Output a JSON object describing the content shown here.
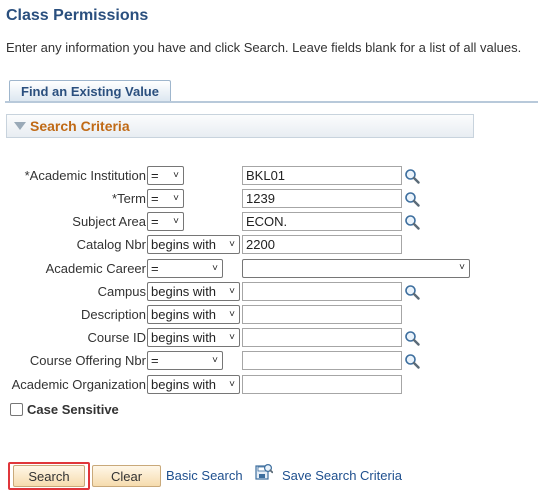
{
  "page": {
    "title": "Class Permissions",
    "instructions": "Enter any information you have and click Search. Leave fields blank for a list of all values."
  },
  "tabs": {
    "find_existing": "Find an Existing Value"
  },
  "criteria": {
    "heading": "Search Criteria"
  },
  "fields": {
    "academic_institution": {
      "label": "*Academic Institution",
      "operator": "=",
      "value": "BKL01"
    },
    "term": {
      "label": "*Term",
      "operator": "=",
      "value": "1239"
    },
    "subject_area": {
      "label": "Subject Area",
      "operator": "=",
      "value": "ECON."
    },
    "catalog_nbr": {
      "label": "Catalog Nbr",
      "operator": "begins with",
      "value": "2200"
    },
    "academic_career": {
      "label": "Academic Career",
      "operator": "=",
      "value": ""
    },
    "campus": {
      "label": "Campus",
      "operator": "begins with",
      "value": ""
    },
    "description": {
      "label": "Description",
      "operator": "begins with",
      "value": ""
    },
    "course_id": {
      "label": "Course ID",
      "operator": "begins with",
      "value": ""
    },
    "course_offering_nbr": {
      "label": "Course Offering Nbr",
      "operator": "=",
      "value": ""
    },
    "academic_organization": {
      "label": "Academic Organization",
      "operator": "begins with",
      "value": ""
    }
  },
  "case_sensitive": {
    "label": "Case Sensitive",
    "checked": false
  },
  "actions": {
    "search": "Search",
    "clear": "Clear",
    "basic_search": "Basic Search",
    "save_search_criteria": "Save Search Criteria"
  },
  "icons": {
    "lookup": "magnifier-icon",
    "save": "save-search-icon",
    "collapse": "triangle-down-icon",
    "dropdown": "chevron-down-icon"
  },
  "colors": {
    "title": "#2a4f7e",
    "heading_accent": "#c06a16",
    "link": "#1e4f8e",
    "highlight": "#e0363b",
    "button_bg": "#f6dcae"
  }
}
